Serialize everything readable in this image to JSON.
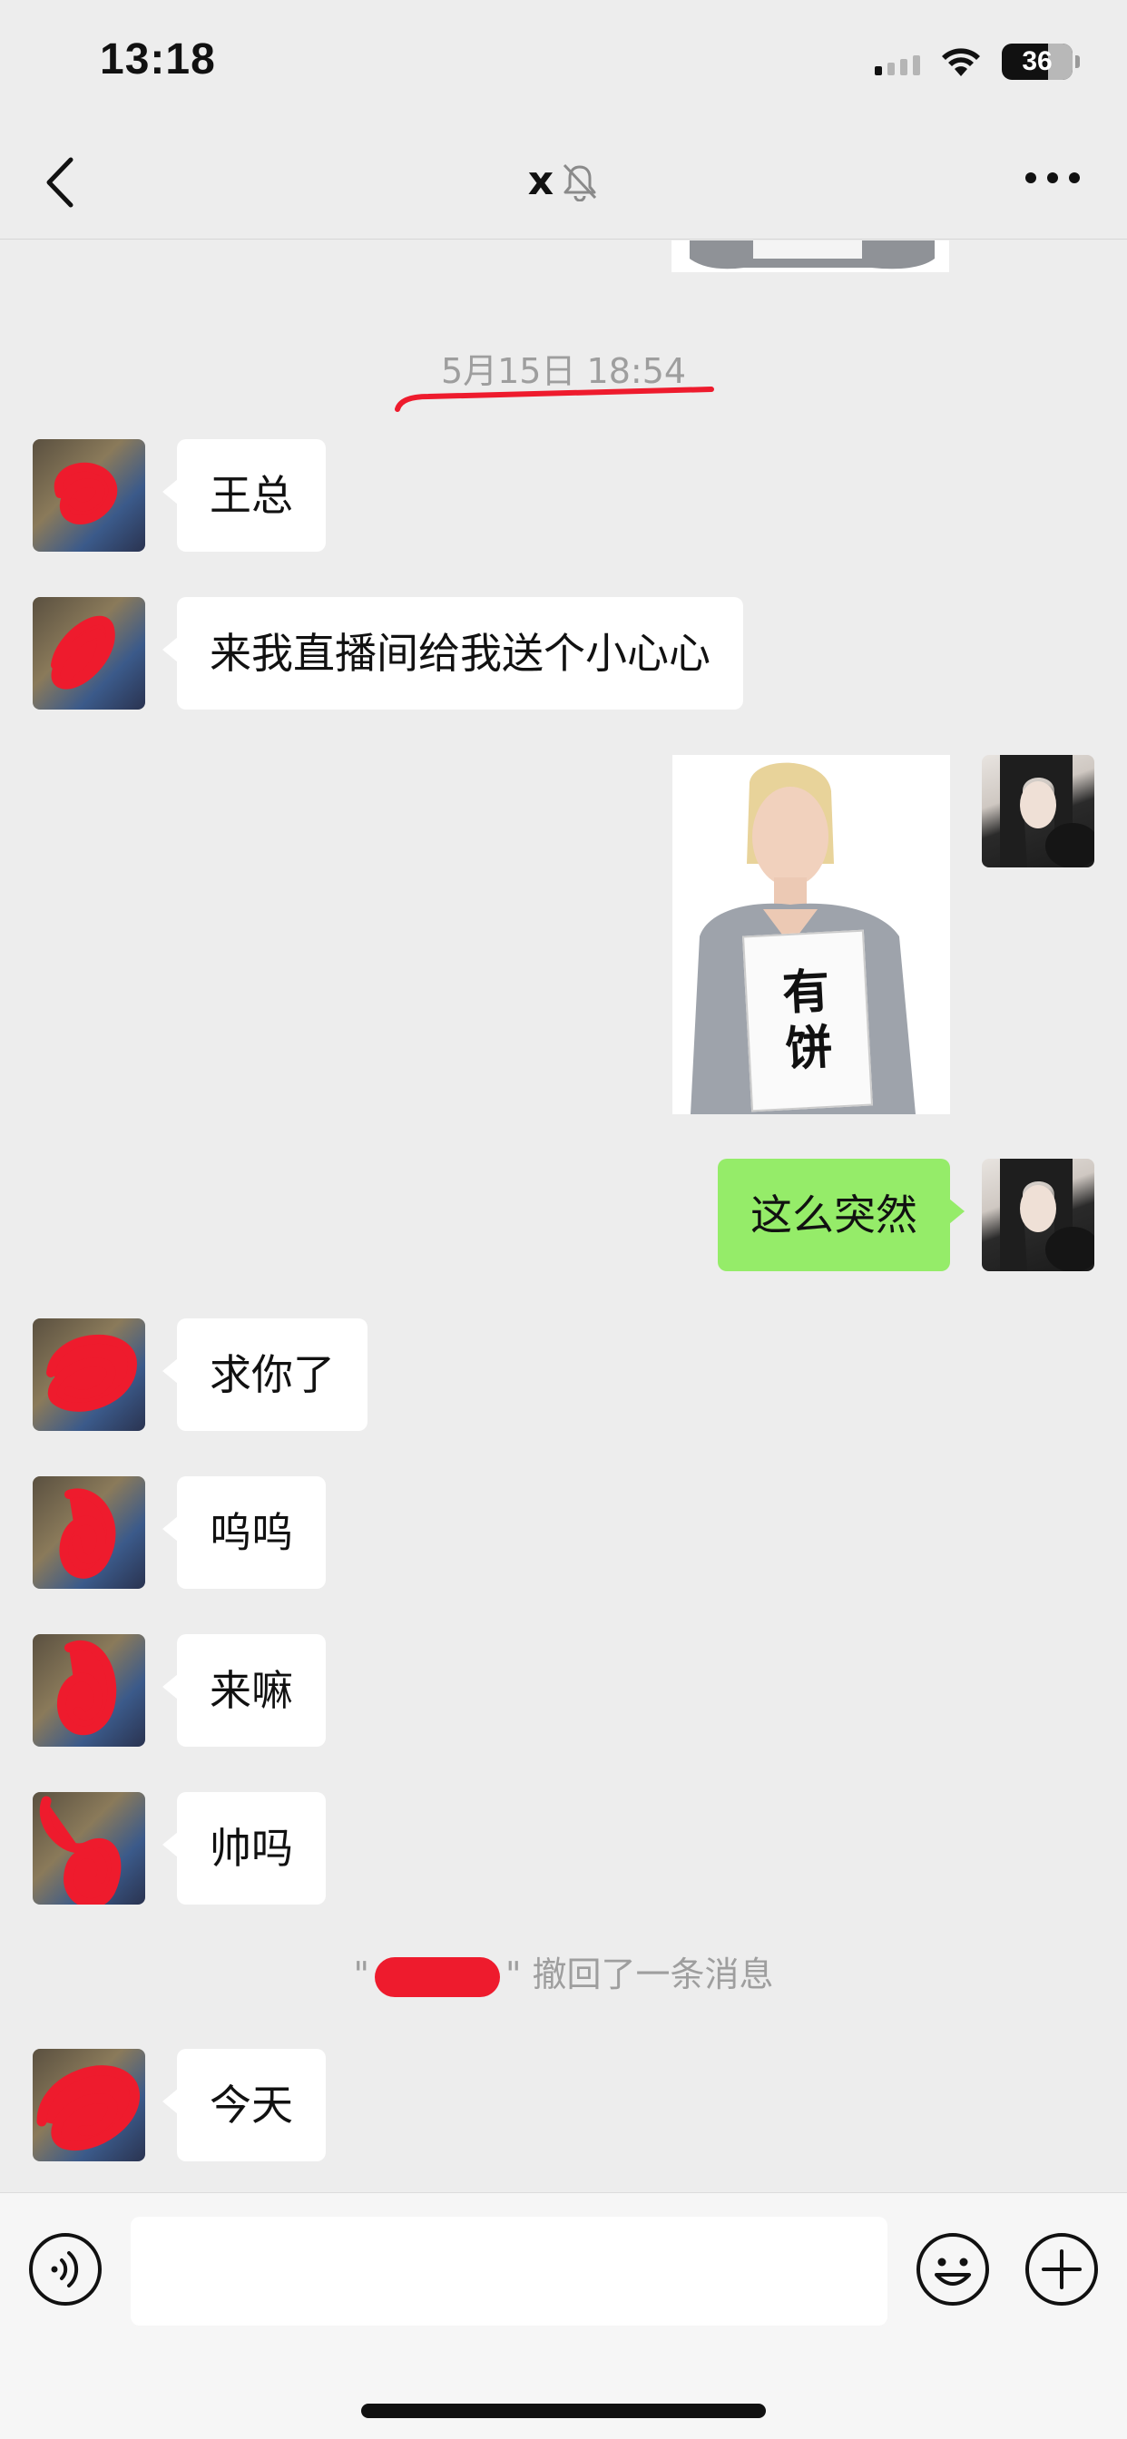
{
  "status_bar": {
    "time": "13:18",
    "battery": "36",
    "icons": [
      "signal-icon",
      "wifi-icon",
      "battery-icon"
    ]
  },
  "nav": {
    "title": "x",
    "icons": [
      "back-icon",
      "mute-bell-icon",
      "more-icon"
    ]
  },
  "chat": {
    "timestamp": "5月15日 18:54",
    "messages": [
      {
        "side": "in",
        "type": "text",
        "text": "王总"
      },
      {
        "side": "in",
        "type": "text",
        "text": "来我直播间给我送个小心心"
      },
      {
        "side": "out",
        "type": "image",
        "sign_lines": [
          "有",
          "饼"
        ]
      },
      {
        "side": "out",
        "type": "text",
        "text": "这么突然"
      },
      {
        "side": "in",
        "type": "text",
        "text": "求你了"
      },
      {
        "side": "in",
        "type": "text",
        "text": "呜呜"
      },
      {
        "side": "in",
        "type": "text",
        "text": "来嘛"
      },
      {
        "side": "in",
        "type": "text",
        "text": "帅吗"
      },
      {
        "side": "in",
        "type": "text",
        "text": "今天"
      }
    ],
    "recall_notice": {
      "open_quote": "\"",
      "close_quote": "\"",
      "text": "撤回了一条消息"
    }
  },
  "input_bar": {
    "placeholder": "",
    "icons": [
      "voice-icon",
      "emoji-icon",
      "plus-icon"
    ]
  },
  "colors": {
    "background": "#ededed",
    "incoming_bubble": "#ffffff",
    "outgoing_bubble": "#95ec69",
    "annotation_red": "#ee1b2d",
    "muted_text": "#9e9e9e"
  }
}
